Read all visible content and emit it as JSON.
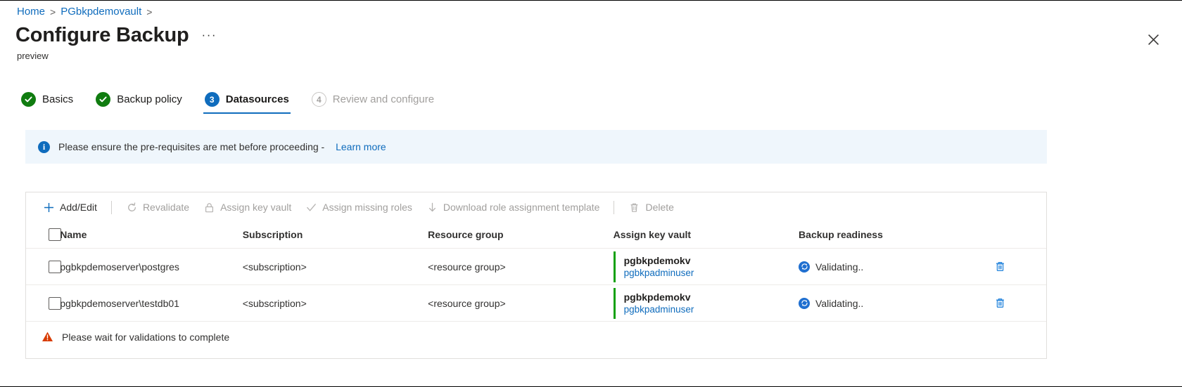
{
  "breadcrumb": {
    "items": [
      {
        "label": "Home"
      },
      {
        "label": "PGbkpdemovault"
      }
    ],
    "separator": ">"
  },
  "header": {
    "title": "Configure Backup",
    "more_label": "···",
    "subtitle": "preview",
    "close_icon": "close-icon"
  },
  "steps": [
    {
      "label": "Basics",
      "state": "done",
      "marker": "check"
    },
    {
      "label": "Backup policy",
      "state": "done",
      "marker": "check"
    },
    {
      "label": "Datasources",
      "state": "active",
      "marker": "3"
    },
    {
      "label": "Review and configure",
      "state": "todo",
      "marker": "4"
    }
  ],
  "info_banner": {
    "icon": "info-icon",
    "text": "Please ensure the pre-requisites are met before proceeding - ",
    "link_label": "Learn more"
  },
  "toolbar": {
    "items": [
      {
        "label": "Add/Edit",
        "icon": "plus-icon",
        "enabled": true
      },
      {
        "label": "Revalidate",
        "icon": "refresh-icon",
        "enabled": false
      },
      {
        "label": "Assign key vault",
        "icon": "lock-icon",
        "enabled": false
      },
      {
        "label": "Assign missing roles",
        "icon": "check-icon",
        "enabled": false
      },
      {
        "label": "Download role assignment template",
        "icon": "download-icon",
        "enabled": false
      },
      {
        "label": "Delete",
        "icon": "trash-icon",
        "enabled": false
      }
    ]
  },
  "table": {
    "select_all_icon": "checkbox-icon",
    "columns": [
      "Name",
      "Subscription",
      "Resource group",
      "Assign key vault",
      "Backup readiness"
    ],
    "rows": [
      {
        "name": "pgbkpdemoserver\\postgres",
        "subscription": "<subscription>",
        "resource_group": "<resource group>",
        "key_vault": "pgbkpdemokv",
        "key_vault_user": "pgbkpadminuser",
        "readiness": "Validating..",
        "readiness_icon": "sync-icon",
        "delete_icon": "trash-icon"
      },
      {
        "name": "pgbkpdemoserver\\testdb01",
        "subscription": "<subscription>",
        "resource_group": "<resource group>",
        "key_vault": "pgbkpdemokv",
        "key_vault_user": "pgbkpadminuser",
        "readiness": "Validating..",
        "readiness_icon": "sync-icon",
        "delete_icon": "trash-icon"
      }
    ]
  },
  "footer_warning": {
    "icon": "warning-icon",
    "text": "Please wait for validations to complete"
  },
  "colors": {
    "accent": "#0f6cbd",
    "success": "#107c10",
    "kv_bar": "#13a10e",
    "warning": "#d83b01",
    "info_bg": "#eff6fc",
    "border": "#e1dfdd"
  }
}
